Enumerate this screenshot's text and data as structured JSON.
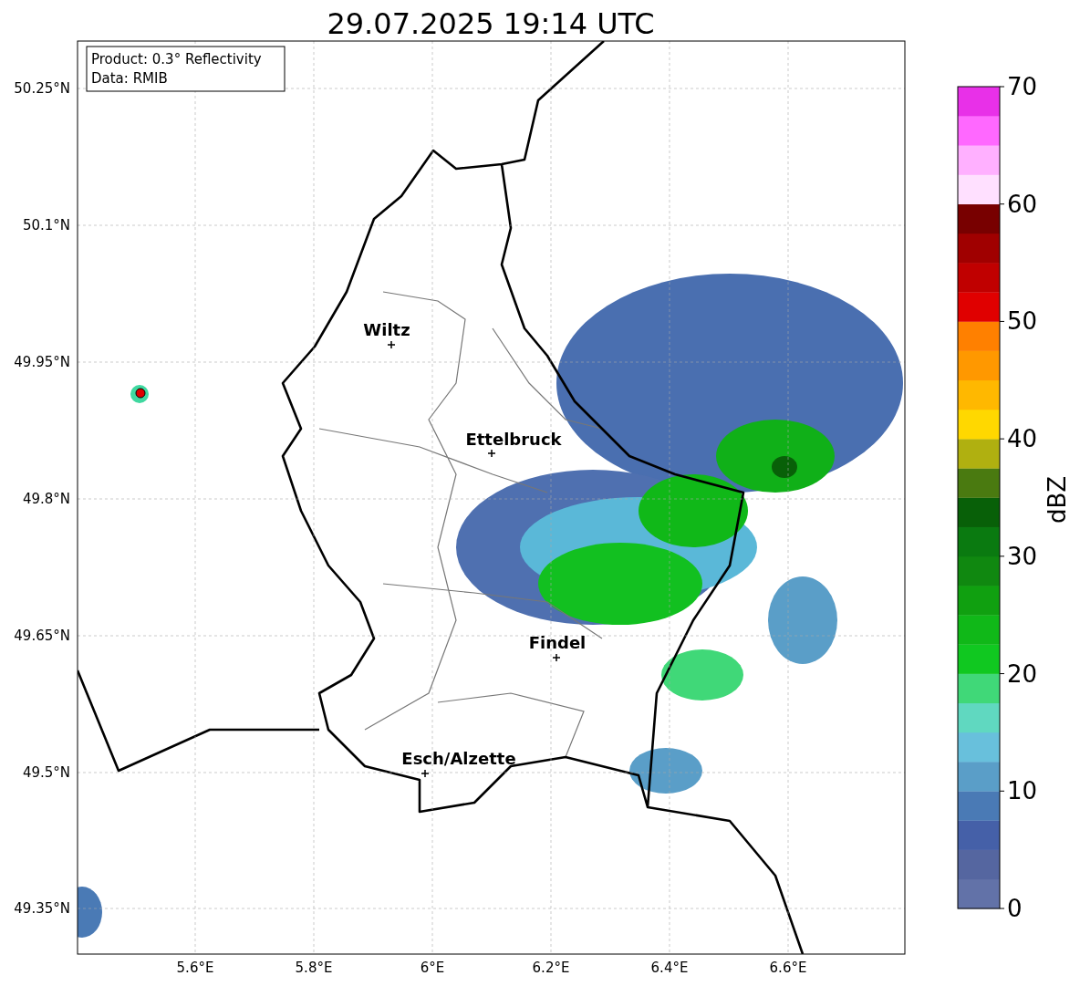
{
  "title": "29.07.2025 19:14 UTC",
  "info_box": {
    "lines": [
      "Product: 0.3° Reflectivity",
      "Data: RMIB"
    ]
  },
  "map": {
    "y_ticks": [
      "50.25°N",
      "50.1°N",
      "49.95°N",
      "49.8°N",
      "49.65°N",
      "49.5°N",
      "49.35°N"
    ],
    "x_ticks": [
      "5.6°E",
      "5.8°E",
      "6°E",
      "6.2°E",
      "6.4°E",
      "6.6°E"
    ],
    "places": [
      {
        "name": "Wiltz"
      },
      {
        "name": "Ettelbruck"
      },
      {
        "name": "Findel"
      },
      {
        "name": "Esch/Alzette"
      }
    ]
  },
  "colorbar": {
    "label": "dBZ",
    "ticks": [
      "70",
      "60",
      "50",
      "40",
      "30",
      "20",
      "10",
      "0"
    ],
    "bands": [
      {
        "color": "#6272a8"
      },
      {
        "color": "#5566a0"
      },
      {
        "color": "#4560a8"
      },
      {
        "color": "#4a7ab5"
      },
      {
        "color": "#5a9ec8"
      },
      {
        "color": "#68c0dc"
      },
      {
        "color": "#60d8c0"
      },
      {
        "color": "#40d878"
      },
      {
        "color": "#10c820"
      },
      {
        "color": "#10b818"
      },
      {
        "color": "#10a010"
      },
      {
        "color": "#108810"
      },
      {
        "color": "#0a7a10"
      },
      {
        "color": "#086008"
      },
      {
        "color": "#4a7a10"
      },
      {
        "color": "#b0b010"
      },
      {
        "color": "#ffd800"
      },
      {
        "color": "#ffb800"
      },
      {
        "color": "#ff9800"
      },
      {
        "color": "#ff8000"
      },
      {
        "color": "#e00000"
      },
      {
        "color": "#c00000"
      },
      {
        "color": "#a00000"
      },
      {
        "color": "#780000"
      },
      {
        "color": "#ffe0ff"
      },
      {
        "color": "#ffb0ff"
      },
      {
        "color": "#ff68ff"
      },
      {
        "color": "#e830e8"
      }
    ]
  }
}
